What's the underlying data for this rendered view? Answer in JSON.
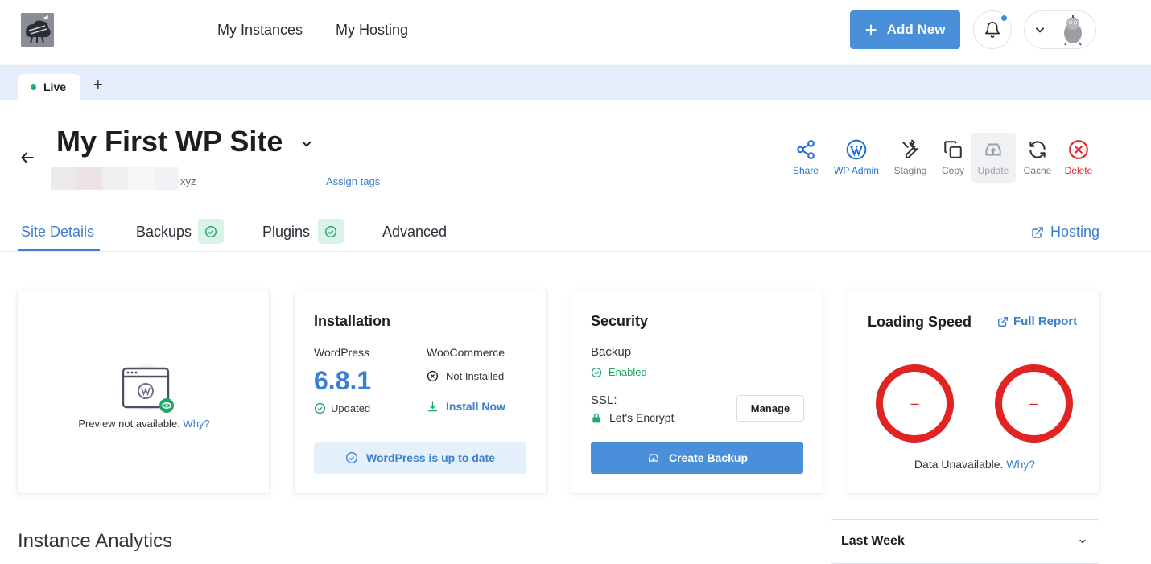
{
  "nav": {
    "links": [
      "My Instances",
      "My Hosting"
    ],
    "add_new": "Add New",
    "colors": {
      "primary": "#4a8fd9",
      "notification_dot": "#3f8be0"
    }
  },
  "env_tabs": {
    "live": "Live",
    "add": "+"
  },
  "site": {
    "title": "My First WP Site",
    "domain_suffix": "xyz",
    "assign_tags": "Assign tags"
  },
  "actions": [
    {
      "label": "Share",
      "icon": "share-icon",
      "color": "#1f6fd1"
    },
    {
      "label": "WP Admin",
      "icon": "wordpress-icon",
      "color": "#1f6fd1"
    },
    {
      "label": "Staging",
      "icon": "wrench-icon",
      "color": "#777b82"
    },
    {
      "label": "Copy",
      "icon": "copy-icon",
      "color": "#777b82"
    },
    {
      "label": "Update",
      "icon": "update-icon",
      "color": "#9aa0a7"
    },
    {
      "label": "Cache",
      "icon": "refresh-icon",
      "color": "#777b82"
    },
    {
      "label": "Delete",
      "icon": "delete-icon",
      "color": "#e02424"
    }
  ],
  "tabs": {
    "site_details": "Site Details",
    "backups": "Backups",
    "plugins": "Plugins",
    "advanced": "Advanced",
    "hosting": "Hosting"
  },
  "preview": {
    "text": "Preview not available.",
    "why": "Why?"
  },
  "installation": {
    "title": "Installation",
    "wp_label": "WordPress",
    "wp_version": "6.8.1",
    "wp_status": "Updated",
    "woo_label": "WooCommerce",
    "woo_status": "Not Installed",
    "install_now": "Install Now",
    "up_to_date": "WordPress is up to date"
  },
  "security": {
    "title": "Security",
    "backup_label": "Backup",
    "backup_status": "Enabled",
    "ssl_label": "SSL:",
    "ssl_value": "Let's Encrypt",
    "manage": "Manage",
    "create_backup": "Create Backup"
  },
  "speed": {
    "title": "Loading Speed",
    "full_report": "Full Report",
    "mobile_value": "–",
    "desktop_value": "–",
    "unavailable": "Data Unavailable.",
    "why": "Why?"
  },
  "analytics": {
    "title": "Instance Analytics",
    "range": "Last Week"
  }
}
